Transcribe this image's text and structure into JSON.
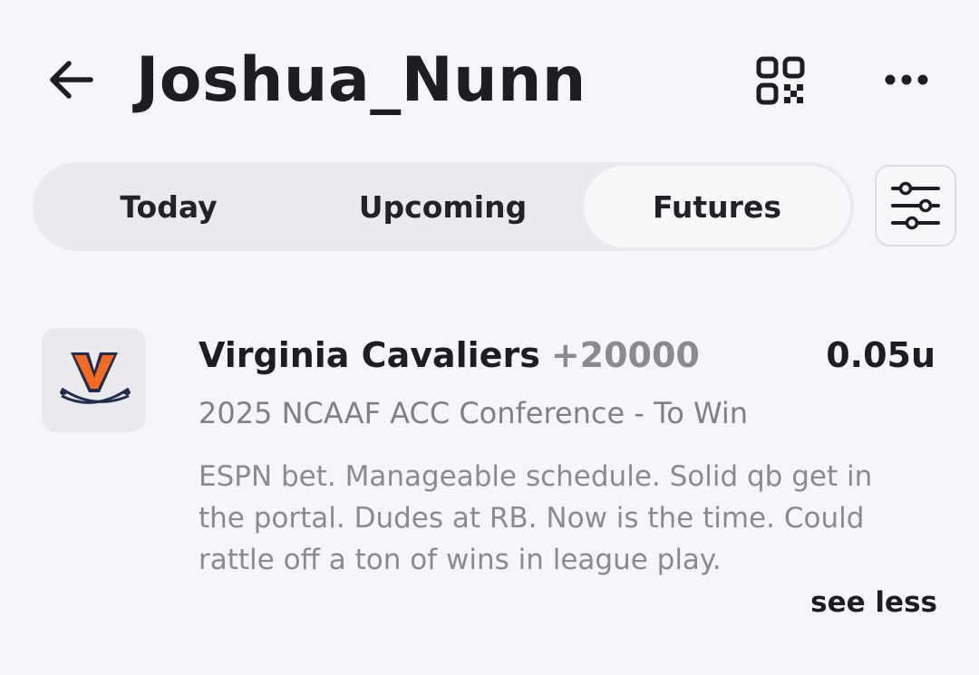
{
  "header": {
    "title": "Joshua_Nunn",
    "back_icon": "arrow-left-icon",
    "qr_icon": "qr-code-icon",
    "more_icon": "more-horizontal-icon"
  },
  "tabs": [
    {
      "label": "Today",
      "selected": false
    },
    {
      "label": "Upcoming",
      "selected": false
    },
    {
      "label": "Futures",
      "selected": true
    }
  ],
  "filter": {
    "icon": "sliders-icon"
  },
  "bet": {
    "team": "Virginia Cavaliers",
    "odds": "+20000",
    "units": "0.05u",
    "market": "2025 NCAAF ACC Conference - To Win",
    "notes": "ESPN bet. Manageable schedule. Solid qb get in the portal. Dudes at RB. Now is the time. Could rattle off a ton of wins in league play.",
    "toggle_label": "see less",
    "logo": "virginia-cavaliers-logo"
  },
  "colors": {
    "background": "#f6f6fa",
    "tab_bg": "#e9e9ee",
    "tab_selected_bg": "#f8f8fb",
    "muted_text": "#8a8a90",
    "logo_orange": "#f26b21",
    "logo_navy": "#232d4b"
  }
}
